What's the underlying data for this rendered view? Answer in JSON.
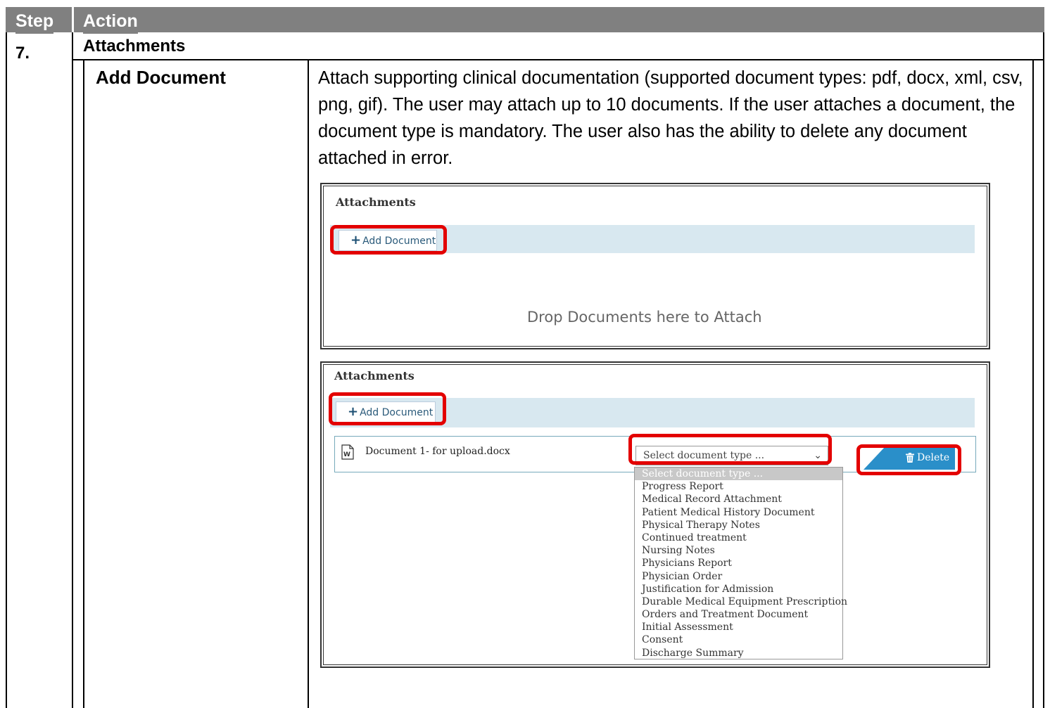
{
  "table": {
    "header_step": "Step",
    "header_action": "Action",
    "step_number": "7.",
    "section_title": "Attachments",
    "action_title": "Add Document",
    "description": "Attach supporting clinical documentation (supported document types: pdf, docx, xml, csv, png, gif). The user may attach up to 10 documents. If the user attaches a document, the document type is mandatory. The user also has the ability to delete any document attached in error."
  },
  "screenshot1": {
    "title": "Attachments",
    "add_button": "Add Document",
    "drop_text": "Drop Documents here to Attach"
  },
  "screenshot2": {
    "title": "Attachments",
    "add_button": "Add Document",
    "file_name": "Document 1- for upload.docx",
    "select_placeholder": "Select document type ...",
    "delete_button": "Delete",
    "options": [
      "Select document type ...",
      "Progress Report",
      "Medical Record Attachment",
      "Patient Medical History Document",
      "Physical Therapy Notes",
      "Continued treatment",
      "Nursing Notes",
      "Physicians Report",
      "Physician Order",
      "Justification for Admission",
      "Durable Medical Equipment Prescription",
      "Orders and Treatment Document",
      "Initial Assessment",
      "Consent",
      "Discharge Summary"
    ]
  },
  "icons": {
    "plus": "plus-icon",
    "word_doc": "word-document-icon",
    "trash": "trash-icon",
    "chevron": "chevron-down-icon"
  },
  "colors": {
    "header_bg": "#808080",
    "highlight": "#e30000",
    "band": "#d8e8f0",
    "delete_bg": "#2a8fc9"
  }
}
